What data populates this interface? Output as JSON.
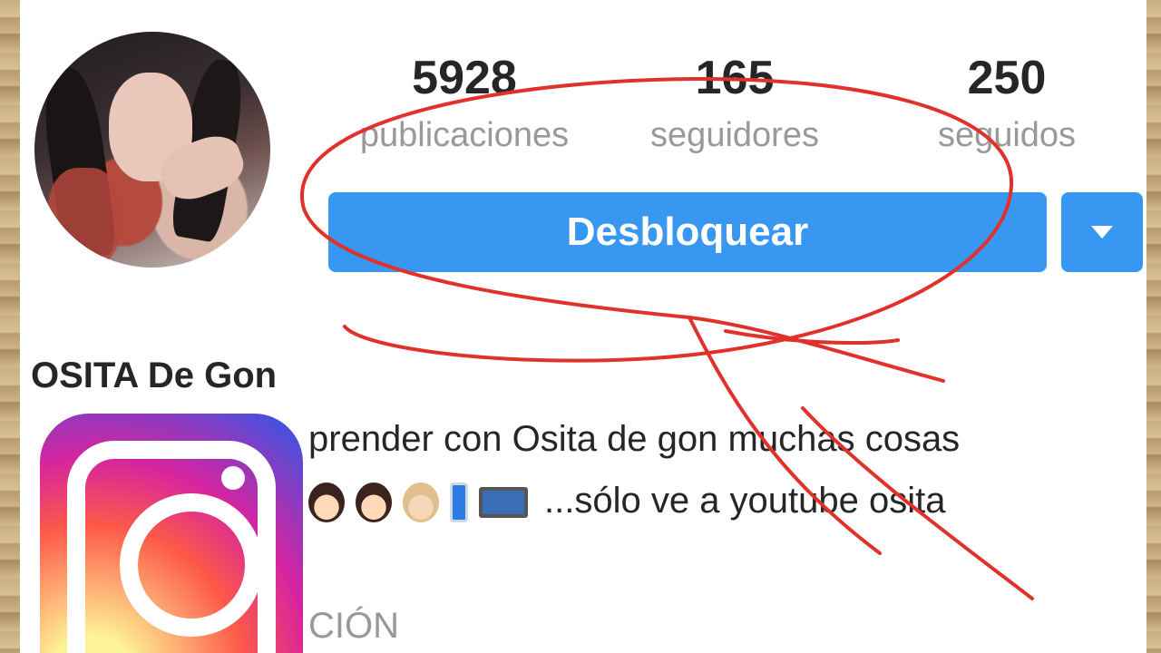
{
  "profile": {
    "name": "OSITA De Gon",
    "stats": [
      {
        "value": "5928",
        "label": "publicaciones"
      },
      {
        "value": "165",
        "label": "seguidores"
      },
      {
        "value": "250",
        "label": "seguidos"
      }
    ],
    "unblock_label": "Desbloquear",
    "bio_line_1": "prender  con Osita de gon muchas cosas",
    "bio_line_2": "...sólo ve a youtube  osita",
    "section_header": "CIÓN"
  },
  "icons": [
    "avatar-photo",
    "caret-down-icon",
    "instagram-logo",
    "girl-emoji",
    "blond-girl-emoji",
    "phone-emoji",
    "laptop-emoji"
  ],
  "colors": {
    "primary_button": "#3897f0",
    "annotation": "#e0312b"
  }
}
